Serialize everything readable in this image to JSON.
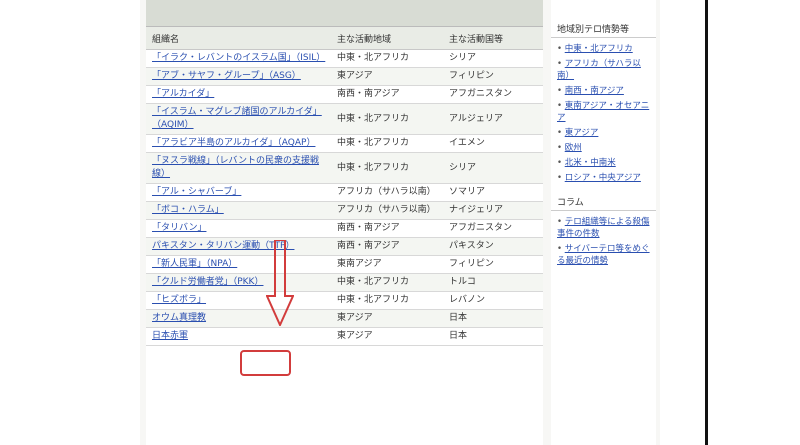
{
  "table": {
    "title": "",
    "headers": [
      "組織名",
      "主な活動地域",
      "主な活動国等"
    ],
    "rows": [
      {
        "name": "「イラク・レバントのイスラム国」（ISIL）",
        "region": "中東・北アフリカ",
        "country": "シリア"
      },
      {
        "name": "「アブ・サヤフ・グループ」（ASG）",
        "region": "東アジア",
        "country": "フィリピン"
      },
      {
        "name": "「アルカイダ」",
        "region": "南西・南アジア",
        "country": "アフガニスタン"
      },
      {
        "name": "「イスラム・マグレブ諸国のアルカイダ」（AQIM）",
        "region": "中東・北アフリカ",
        "country": "アルジェリア"
      },
      {
        "name": "「アラビア半島のアルカイダ」（AQAP）",
        "region": "中東・北アフリカ",
        "country": "イエメン"
      },
      {
        "name": "「ヌスラ戦線」（レバントの民衆の支援戦線）",
        "region": "中東・北アフリカ",
        "country": "シリア"
      },
      {
        "name": "「アル・シャバーブ」",
        "region": "アフリカ（サハラ以南）",
        "country": "ソマリア"
      },
      {
        "name": "「ボコ・ハラム」",
        "region": "アフリカ（サハラ以南）",
        "country": "ナイジェリア"
      },
      {
        "name": "「タリバン」",
        "region": "南西・南アジア",
        "country": "アフガニスタン"
      },
      {
        "name": "パキスタン・タリバン運動（TTP）",
        "region": "南西・南アジア",
        "country": "パキスタン"
      },
      {
        "name": "「新人民軍」（NPA）",
        "region": "東南アジア",
        "country": "フィリピン"
      },
      {
        "name": "「クルド労働者党」（PKK）",
        "region": "中東・北アフリカ",
        "country": "トルコ"
      },
      {
        "name": "「ヒズボラ」",
        "region": "中東・北アフリカ",
        "country": "レバノン"
      },
      {
        "name": "オウム真理教",
        "region": "東アジア",
        "country": "日本"
      },
      {
        "name": "日本赤軍",
        "region": "東アジア",
        "country": "日本"
      }
    ]
  },
  "sidebar": {
    "top_text": "",
    "feature_link": "",
    "section_region": "地域別テロ情勢等",
    "regions": [
      "中東・北アフリカ",
      "アフリカ（サハラ以南）",
      "南西・南アジア",
      "東南アジア・オセアニア",
      "東アジア",
      "欧州",
      "北米・中南米",
      "ロシア・中央アジア"
    ],
    "section_column": "コラム",
    "columns": [
      "テロ組織等による殺傷事件の件数",
      "サイバーテロ等をめぐる最近の情勢"
    ]
  },
  "annotation": {
    "highlight_color": "#d23c3c"
  }
}
